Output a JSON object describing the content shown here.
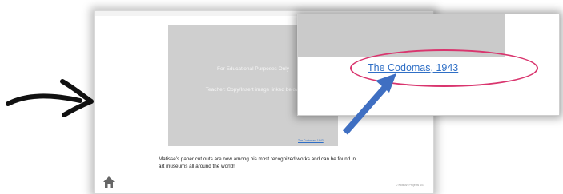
{
  "placeholder": {
    "line1": "For Educational Purposes Only",
    "line2": "Teacher: Copy/Insert image linked below."
  },
  "slide": {
    "image_link": "The Codomas, 1943",
    "caption": "Matisse’s paper cut outs are now among his most recognized works and can be found in art museums all around the world!",
    "copyright": "© Kids Art Projects 101",
    "home_icon": "home-icon"
  },
  "zoom": {
    "image_link": "The Codomas, 1943"
  },
  "colors": {
    "link": "#2f6fc6",
    "highlight_ellipse": "#d9356e",
    "callout_arrow": "#3f6fc2",
    "placeholder": "#cfcfcf"
  }
}
